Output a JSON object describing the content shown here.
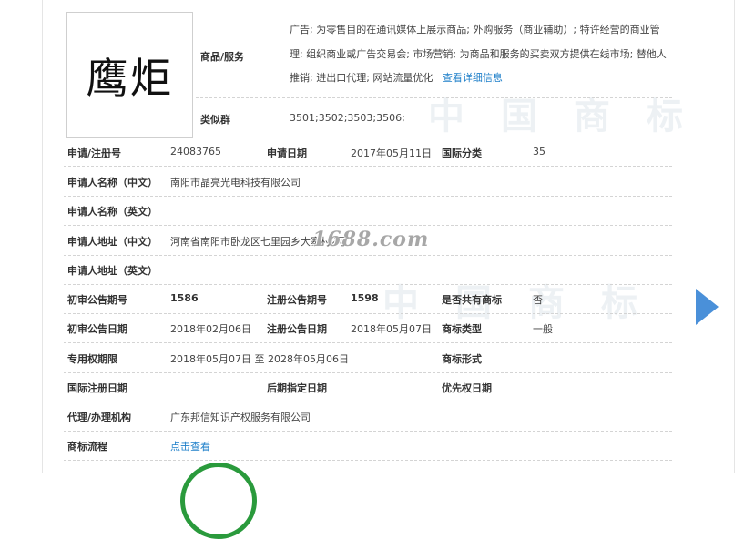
{
  "trademark": {
    "logo_text": "鹰炬"
  },
  "goods": {
    "label": "商品/服务",
    "text": "广告; 为零售目的在通讯媒体上展示商品; 外购服务（商业辅助）; 特许经营的商业管理; 组织商业或广告交易会; 市场营销; 为商品和服务的买卖双方提供在线市场; 替他人推销; 进出口代理; 网站流量优化",
    "more_link": "查看详细信息"
  },
  "similar_group": {
    "label": "类似群",
    "value": "3501;3502;3503;3506;"
  },
  "rows": {
    "reg_no": {
      "label": "申请/注册号",
      "value": "24083765"
    },
    "app_date": {
      "label": "申请日期",
      "value": "2017年05月11日"
    },
    "intl_class": {
      "label": "国际分类",
      "value": "35"
    },
    "applicant_cn": {
      "label": "申请人名称（中文）",
      "value": "南阳市晶亮光电科技有限公司"
    },
    "applicant_en": {
      "label": "申请人名称（英文）",
      "value": ""
    },
    "address_cn": {
      "label": "申请人地址（中文）",
      "value": "河南省南阳市卧龙区七里园乡大寨村2号"
    },
    "address_en": {
      "label": "申请人地址（英文）",
      "value": ""
    },
    "prelim_issue": {
      "label": "初审公告期号",
      "value": "1586"
    },
    "reg_issue": {
      "label": "注册公告期号",
      "value": "1598"
    },
    "shared": {
      "label": "是否共有商标",
      "value": "否"
    },
    "prelim_date": {
      "label": "初审公告日期",
      "value": "2018年02月06日"
    },
    "reg_date": {
      "label": "注册公告日期",
      "value": "2018年05月07日"
    },
    "tm_type": {
      "label": "商标类型",
      "value": "一般"
    },
    "exclusive": {
      "label": "专用权期限",
      "value": "2018年05月07日 至 2028年05月06日"
    },
    "tm_form": {
      "label": "商标形式",
      "value": ""
    },
    "intl_reg_date": {
      "label": "国际注册日期",
      "value": ""
    },
    "later_date": {
      "label": "后期指定日期",
      "value": ""
    },
    "priority_date": {
      "label": "优先权日期",
      "value": ""
    },
    "agent": {
      "label": "代理/办理机构",
      "value": "广东邦信知识产权服务有限公司"
    },
    "process": {
      "label": "商标流程",
      "value": "点击查看"
    }
  },
  "site_watermark": "1688.com",
  "bg_watermark": "中国商标",
  "colors": {
    "link": "#1e7fc9",
    "arrow": "#4a90d9",
    "stamp": "#2a9a3c"
  }
}
